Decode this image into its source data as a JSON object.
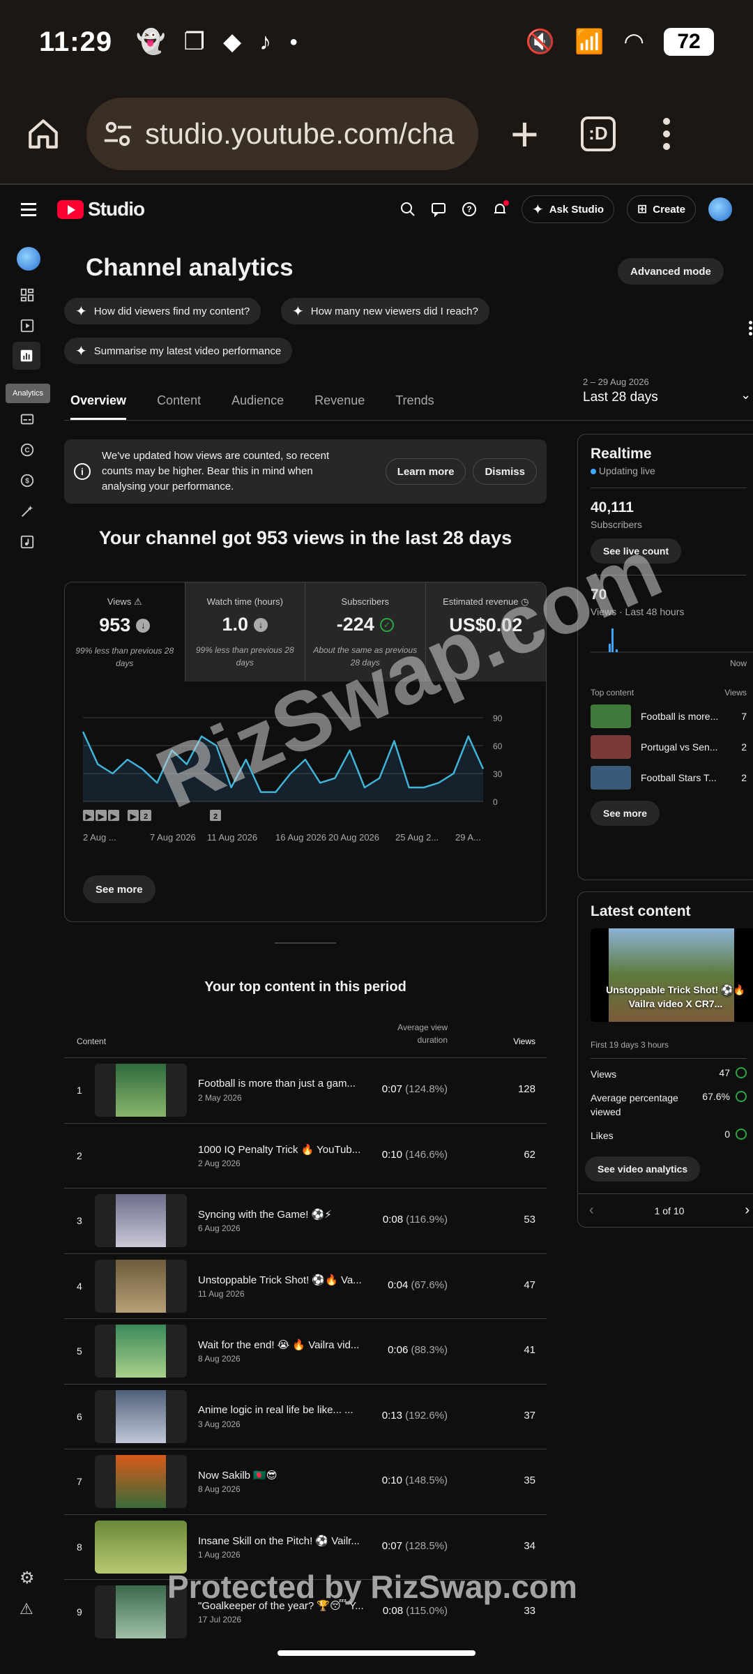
{
  "statusbar": {
    "time": "11:29",
    "battery": "72"
  },
  "browser": {
    "url": "studio.youtube.com/cha",
    "tabs_label": ":D"
  },
  "header": {
    "logo": "Studio",
    "ask_studio": "Ask Studio",
    "create": "Create"
  },
  "rail": {
    "tooltip": "Analytics"
  },
  "page": {
    "title": "Channel analytics",
    "advanced": "Advanced mode",
    "chips": [
      "How did viewers find my content?",
      "How many new viewers did I reach?",
      "Summarise my latest video performance"
    ],
    "tabs": [
      "Overview",
      "Content",
      "Audience",
      "Revenue",
      "Trends"
    ],
    "date_small": "2 – 29 Aug 2026",
    "date_large": "Last 28 days"
  },
  "notice": {
    "text": "We've updated how views are counted, so recent counts may be higher. Bear this in mind when analysing your performance.",
    "learn": "Learn more",
    "dismiss": "Dismiss"
  },
  "headline": "Your channel got 953 views in the last 28 days",
  "metrics": [
    {
      "label": "Views",
      "value": "953",
      "sub": "99% less than previous 28 days"
    },
    {
      "label": "Watch time (hours)",
      "value": "1.0",
      "sub": "99% less than previous 28 days"
    },
    {
      "label": "Subscribers",
      "value": "-224",
      "sub": "About the same as previous 28 days"
    },
    {
      "label": "Estimated revenue",
      "value": "US$0.02",
      "sub": ""
    }
  ],
  "chart_data": {
    "type": "area",
    "x_ticks": [
      "2 Aug ...",
      "7 Aug 2026",
      "11 Aug 2026",
      "16 Aug 2026",
      "20 Aug 2026",
      "25 Aug 2...",
      "29 A..."
    ],
    "y_ticks": [
      "0",
      "30",
      "60",
      "90"
    ],
    "ylim": [
      0,
      90
    ],
    "values": [
      75,
      40,
      30,
      45,
      35,
      20,
      55,
      40,
      70,
      60,
      15,
      45,
      10,
      10,
      30,
      45,
      20,
      25,
      55,
      15,
      25,
      65,
      15,
      15,
      20,
      30,
      70,
      35
    ],
    "markers": [
      "",
      "",
      "",
      "",
      "2",
      "2"
    ]
  },
  "chart": {
    "see_more": "See more"
  },
  "top_content": {
    "title": "Your top content in this period",
    "col_content": "Content",
    "col_duration": "Average view duration",
    "col_views": "Views",
    "rows": [
      {
        "rank": "1",
        "title": "Football is more than just a gam...",
        "date": "2 May 2026",
        "dur": "0:07",
        "pct": "(124.8%)",
        "views": "128"
      },
      {
        "rank": "2",
        "title": "1000 IQ Penalty Trick 🔥 YouTub...",
        "date": "2 Aug 2026",
        "dur": "0:10",
        "pct": "(146.6%)",
        "views": "62"
      },
      {
        "rank": "3",
        "title": "Syncing with the Game! ⚽⚡",
        "date": "6 Aug 2026",
        "dur": "0:08",
        "pct": "(116.9%)",
        "views": "53"
      },
      {
        "rank": "4",
        "title": "Unstoppable Trick Shot! ⚽🔥 Va...",
        "date": "11 Aug 2026",
        "dur": "0:04",
        "pct": "(67.6%)",
        "views": "47"
      },
      {
        "rank": "5",
        "title": "Wait for the end! 😭 🔥 Vailra vid...",
        "date": "8 Aug 2026",
        "dur": "0:06",
        "pct": "(88.3%)",
        "views": "41"
      },
      {
        "rank": "6",
        "title": "Anime logic in real life be like... ...",
        "date": "3 Aug 2026",
        "dur": "0:13",
        "pct": "(192.6%)",
        "views": "37"
      },
      {
        "rank": "7",
        "title": "Now Sakilb 🇧🇩😎",
        "date": "8 Aug 2026",
        "dur": "0:10",
        "pct": "(148.5%)",
        "views": "35"
      },
      {
        "rank": "8",
        "title": "Insane Skill on the Pitch! ⚽ Vailr...",
        "date": "1 Aug 2026",
        "dur": "0:07",
        "pct": "(128.5%)",
        "views": "34"
      },
      {
        "rank": "9",
        "title": "\"Goalkeeper of the year? 🏆😴 Y...",
        "date": "17 Jul 2026",
        "dur": "0:08",
        "pct": "(115.0%)",
        "views": "33"
      }
    ]
  },
  "realtime": {
    "title": "Realtime",
    "live": "Updating live",
    "subs_value": "40,111",
    "subs_label": "Subscribers",
    "live_count": "See live count",
    "views_value": "70",
    "views_label": "Views · Last 48 hours",
    "now": "Now",
    "top_content": "Top content",
    "views_col": "Views",
    "items": [
      {
        "title": "Football is more...",
        "views": "7"
      },
      {
        "title": "Portugal vs Sen...",
        "views": "2"
      },
      {
        "title": "Football Stars T...",
        "views": "2"
      }
    ],
    "see_more": "See more"
  },
  "latest": {
    "title": "Latest content",
    "video_title": "Unstoppable Trick Shot! ⚽🔥 Vailra video X CR7...",
    "age": "First 19 days 3 hours",
    "stats": [
      {
        "label": "Views",
        "value": "47"
      },
      {
        "label": "Average percentage viewed",
        "value": "67.6%"
      },
      {
        "label": "Likes",
        "value": "0"
      }
    ],
    "analytics": "See video analytics",
    "pager": "1 of 10"
  },
  "watermark": {
    "main": "RizSwap.com",
    "bottom": "Protected by RizSwap.com"
  }
}
